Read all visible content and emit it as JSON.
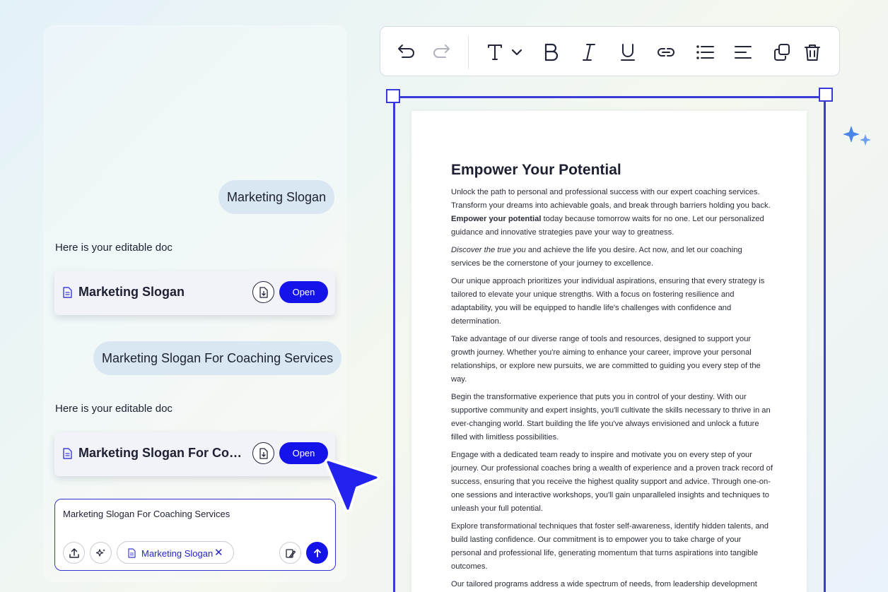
{
  "chat": {
    "messages": [
      {
        "role": "user",
        "text": "Marketing Slogan"
      },
      {
        "role": "assistant",
        "text": "Here is your editable doc"
      },
      {
        "role": "user",
        "text": "Marketing Slogan For Coaching Services"
      },
      {
        "role": "assistant",
        "text": "Here is your editable doc"
      }
    ],
    "doc_cards": [
      {
        "title": "Marketing Slogan",
        "download_icon": "download-doc-icon",
        "open_label": "Open"
      },
      {
        "title": "Marketing Slogan For Coaching Services",
        "download_icon": "download-doc-icon",
        "open_label": "Open"
      }
    ],
    "input": {
      "value": "Marketing Slogan For Coaching Services",
      "chip_label": "Marketing Slogan",
      "chip_close": "✕"
    }
  },
  "toolbar": {
    "items": [
      "undo-icon",
      "redo-icon",
      "text-style-icon",
      "bold-icon",
      "italic-icon",
      "underline-icon",
      "link-icon",
      "bullet-list-icon",
      "align-icon",
      "duplicate-icon",
      "delete-icon"
    ]
  },
  "document": {
    "heading": "Empower Your Potential",
    "paragraphs": [
      {
        "before": "Unlock the path to personal and professional success with our expert coaching services. Transform your dreams into achievable goals, and break through barriers holding you back. ",
        "bold": "Empower your potential",
        "after": " today because tomorrow waits for no one. Let our personalized guidance and innovative strategies pave your way to greatness."
      },
      {
        "italic": "Discover the true you",
        "after": " and achieve the life you desire. Act now, and let our coaching services be the cornerstone of your journey to excellence."
      },
      {
        "text": "Our unique approach prioritizes your individual aspirations, ensuring that every strategy is tailored to elevate your unique strengths. With a focus on fostering resilience and adaptability, you will be equipped to handle life's challenges with confidence and determination."
      },
      {
        "text": "Take advantage of our diverse range of tools and resources, designed to support your growth journey. Whether you're aiming to enhance your career, improve your personal relationships, or explore new pursuits, we are committed to guiding you every step of the way."
      },
      {
        "text": "Begin the transformative experience that puts you in control of your destiny. With our supportive community and expert insights, you'll cultivate the skills necessary to thrive in an ever-changing world. Start building the life you've always envisioned and unlock a future filled with limitless possibilities."
      },
      {
        "text": "Engage with a dedicated team ready to inspire and motivate you on every step of your journey. Our professional coaches bring a wealth of experience and a proven track record of success, ensuring that you receive the highest quality support and advice. Through one-on-one sessions and interactive workshops, you'll gain unparalleled insights and techniques to unleash your full potential."
      },
      {
        "text": "Explore transformational techniques that foster self-awareness, identify hidden talents, and build lasting confidence. Our commitment is to empower you to take charge of your personal and professional life, generating momentum that turns aspirations into tangible outcomes."
      },
      {
        "text": "Our tailored programs address a wide spectrum of needs, from leadership development"
      }
    ]
  },
  "colors": {
    "accent": "#1414ea",
    "selection": "#3a3ad9",
    "bubble": "#d8e7f1",
    "card": "#f2f3f9"
  }
}
